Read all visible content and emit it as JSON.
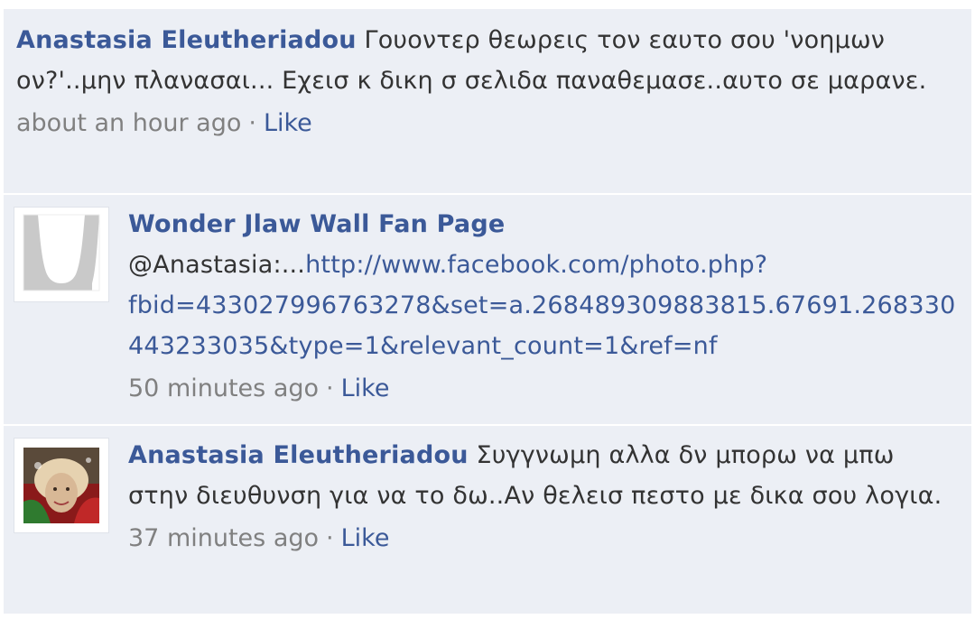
{
  "comments": [
    {
      "author": "Anastasia Eleutheriadou",
      "text": "Γουοντερ θεωρεις τον εαυτο σου 'νοημων ον?'..μην πλανασαι... Εχεισ κ δικη σ σελιδα παναθεμασε..αυτο σε μαρανε.",
      "time": "about an hour ago",
      "separator": "·",
      "like_label": "Like"
    },
    {
      "author": "Wonder Jlaw Wall Fan Page",
      "text": "@Anastasia:...",
      "link": "http://www.facebook.com/photo.php?fbid=433027996763278&set=a.268489309883815.67691.268330443233035&type=1&relevant_count=1&ref=nf",
      "time": "50 minutes ago",
      "separator": "·",
      "like_label": "Like",
      "avatar_icon": "page-profile-picture"
    },
    {
      "author": "Anastasia Eleutheriadou",
      "text": "Συγγνωμη αλλα δν μπορω να μπω στην διευθυνση για να το δω..Αν θελεισ πεστο με δικα σου λογια.",
      "time": "37 minutes ago",
      "separator": "·",
      "like_label": "Like",
      "avatar_icon": "user-profile-picture"
    }
  ],
  "colors": {
    "background": "#eceff5",
    "link": "#3b5998",
    "muted": "#808080",
    "text": "#333333"
  }
}
